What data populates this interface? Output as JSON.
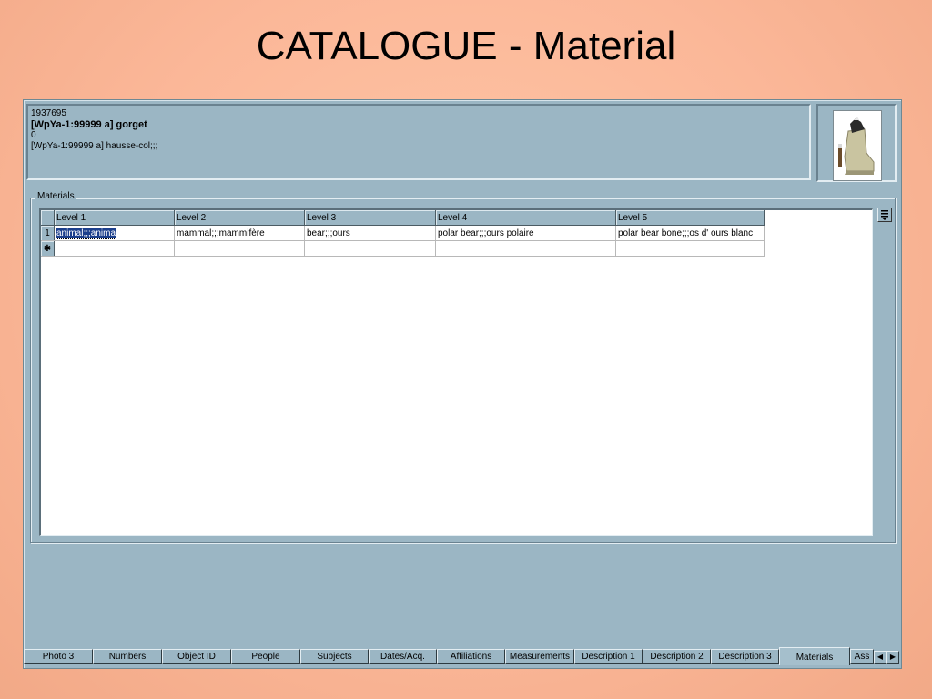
{
  "slide": {
    "title": "CATALOGUE - Material"
  },
  "record": {
    "line1": "1937695",
    "line2": "[WpYa-1:99999 a] gorget",
    "line3": "0",
    "line4": "[WpYa-1:99999 a] hausse-col;;;"
  },
  "materials": {
    "group_label": "Materials",
    "columns": [
      "Level 1",
      "Level 2",
      "Level 3",
      "Level 4",
      "Level 5"
    ],
    "rows": [
      {
        "marker": "1",
        "cells": [
          "animal;;;anima",
          "mammal;;;mammifère",
          "bear;;;ours",
          "polar bear;;;ours polaire",
          "polar bear bone;;;os d' ours blanc"
        ]
      }
    ],
    "new_row_marker": "✱"
  },
  "tabs": [
    "Photo 3",
    "Numbers",
    "Object ID",
    "People",
    "Subjects",
    "Dates/Acq.",
    "Affiliations",
    "Measurements",
    "Description 1",
    "Description 2",
    "Description 3",
    "Materials",
    "Ass"
  ],
  "active_tab": "Materials",
  "icons": {
    "side_button": "list-icon",
    "scroll_left": "arrow-left-icon",
    "scroll_right": "arrow-right-icon"
  },
  "colors": {
    "background": "#fbb798",
    "panel": "#9bb6c4",
    "selection": "#1c3f8c"
  }
}
